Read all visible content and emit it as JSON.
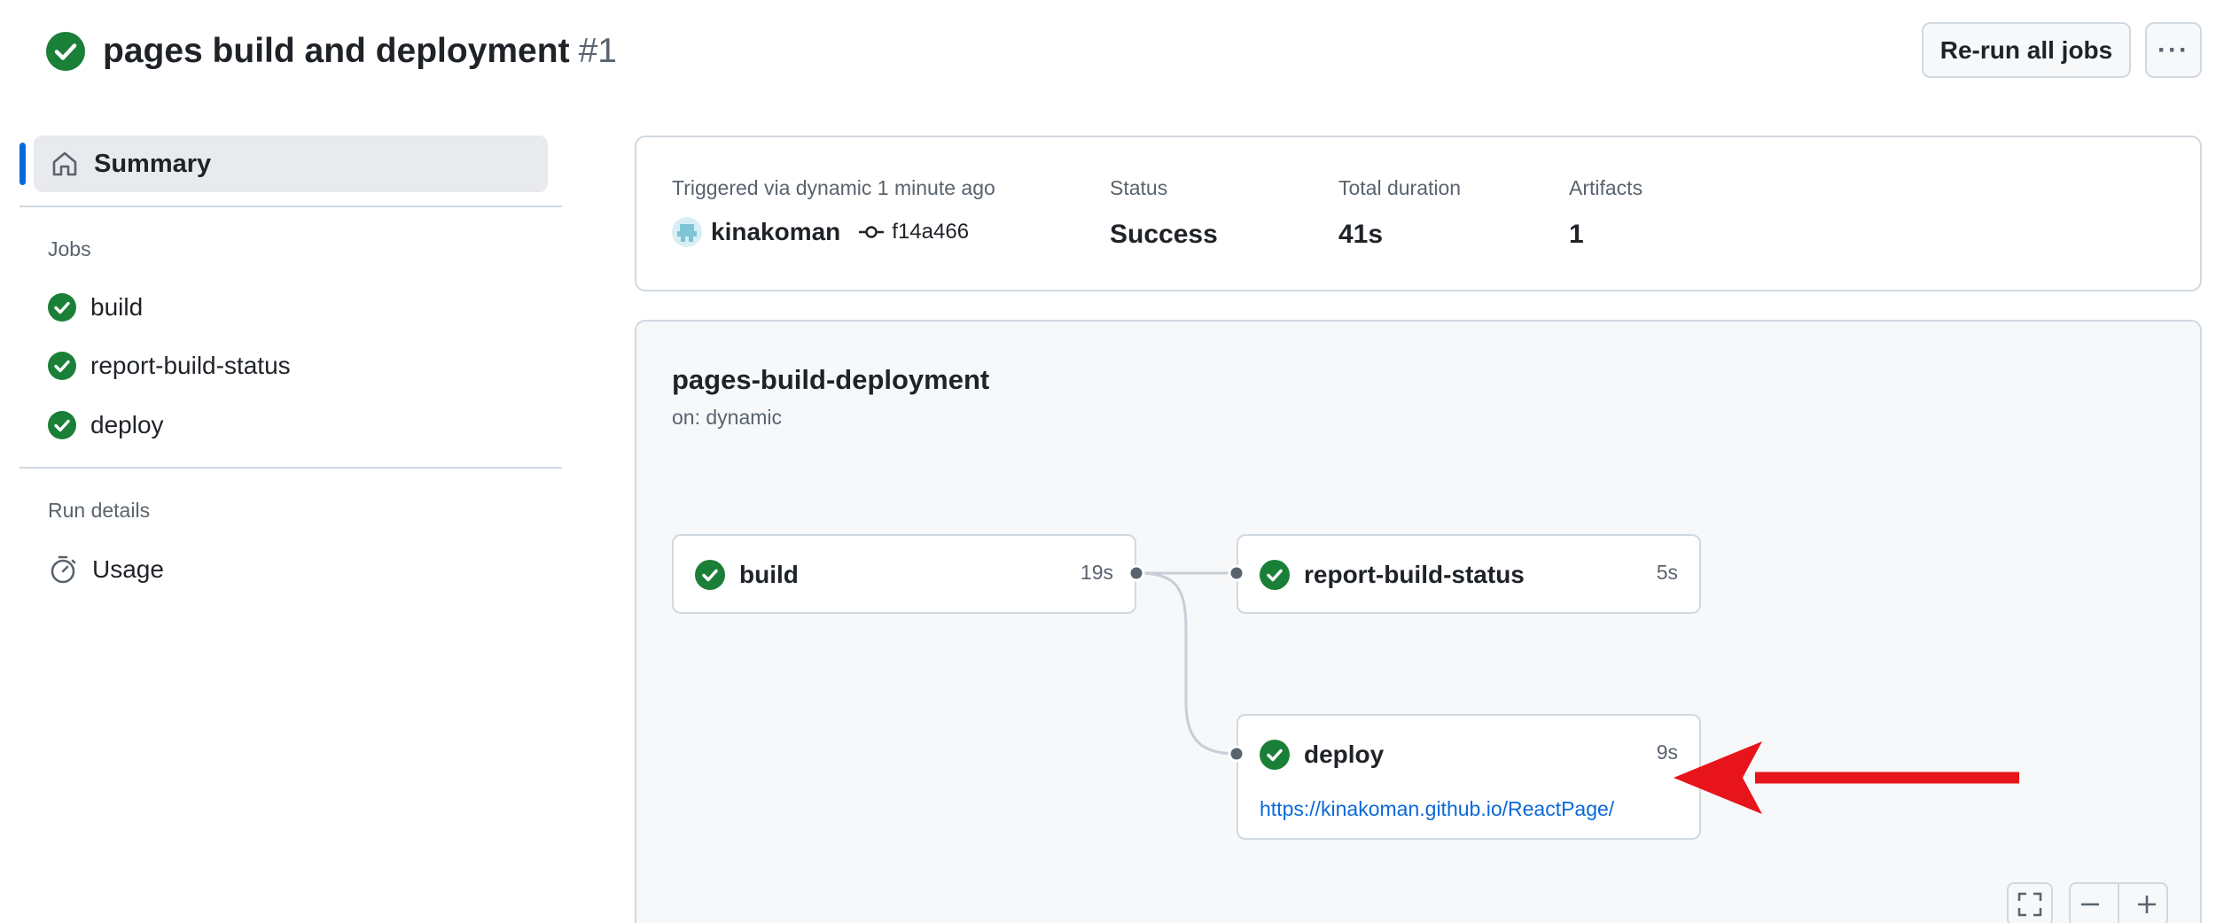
{
  "header": {
    "title": "pages build and deployment",
    "run_number": "#1",
    "rerun_label": "Re-run all jobs",
    "more_label": "···"
  },
  "sidebar": {
    "summary_label": "Summary",
    "jobs_heading": "Jobs",
    "jobs": [
      {
        "label": "build"
      },
      {
        "label": "report-build-status"
      },
      {
        "label": "deploy"
      }
    ],
    "run_details_heading": "Run details",
    "usage_label": "Usage"
  },
  "summary": {
    "triggered_label": "Triggered via dynamic 1 minute ago",
    "actor": "kinakoman",
    "commit": "f14a466",
    "status_label": "Status",
    "status_value": "Success",
    "duration_label": "Total duration",
    "duration_value": "41s",
    "artifacts_label": "Artifacts",
    "artifacts_value": "1"
  },
  "workflow": {
    "name": "pages-build-deployment",
    "trigger": "on: dynamic",
    "jobs": [
      {
        "name": "build",
        "duration": "19s"
      },
      {
        "name": "report-build-status",
        "duration": "5s"
      },
      {
        "name": "deploy",
        "duration": "9s",
        "url": "https://kinakoman.github.io/ReactPage/"
      }
    ]
  },
  "colors": {
    "success": "#1a7f37",
    "accent": "#0969da",
    "annotation_arrow": "#e8141b"
  }
}
